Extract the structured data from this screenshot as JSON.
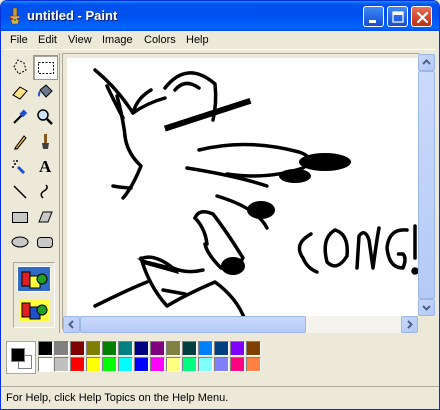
{
  "window": {
    "title": "untitled - Paint"
  },
  "menu": [
    "File",
    "Edit",
    "View",
    "Image",
    "Colors",
    "Help"
  ],
  "tools": [
    {
      "name": "free-form-select-icon"
    },
    {
      "name": "select-icon",
      "selected": true
    },
    {
      "name": "eraser-icon"
    },
    {
      "name": "fill-bucket-icon"
    },
    {
      "name": "pick-color-icon"
    },
    {
      "name": "magnifier-icon"
    },
    {
      "name": "pencil-icon"
    },
    {
      "name": "brush-icon"
    },
    {
      "name": "airbrush-icon"
    },
    {
      "name": "text-icon"
    },
    {
      "name": "line-icon"
    },
    {
      "name": "curve-icon"
    },
    {
      "name": "rectangle-icon"
    },
    {
      "name": "polygon-icon"
    },
    {
      "name": "ellipse-icon"
    },
    {
      "name": "rounded-rectangle-icon"
    }
  ],
  "text_tool_glyph": "A",
  "canvas_text": "CONG!",
  "colors": {
    "foreground": "#000000",
    "background": "#FFFFFF",
    "palette_top": [
      "#000000",
      "#808080",
      "#800000",
      "#808000",
      "#008000",
      "#008080",
      "#000080",
      "#800080",
      "#808040",
      "#004040",
      "#0080FF",
      "#004080",
      "#8000FF",
      "#804000"
    ],
    "palette_bottom": [
      "#FFFFFF",
      "#C0C0C0",
      "#FF0000",
      "#FFFF00",
      "#00FF00",
      "#00FFFF",
      "#0000FF",
      "#FF00FF",
      "#FFFF80",
      "#00FF80",
      "#80FFFF",
      "#8080FF",
      "#FF0080",
      "#FF8040"
    ]
  },
  "status": {
    "text": "For Help, click Help Topics on the Help Menu."
  }
}
